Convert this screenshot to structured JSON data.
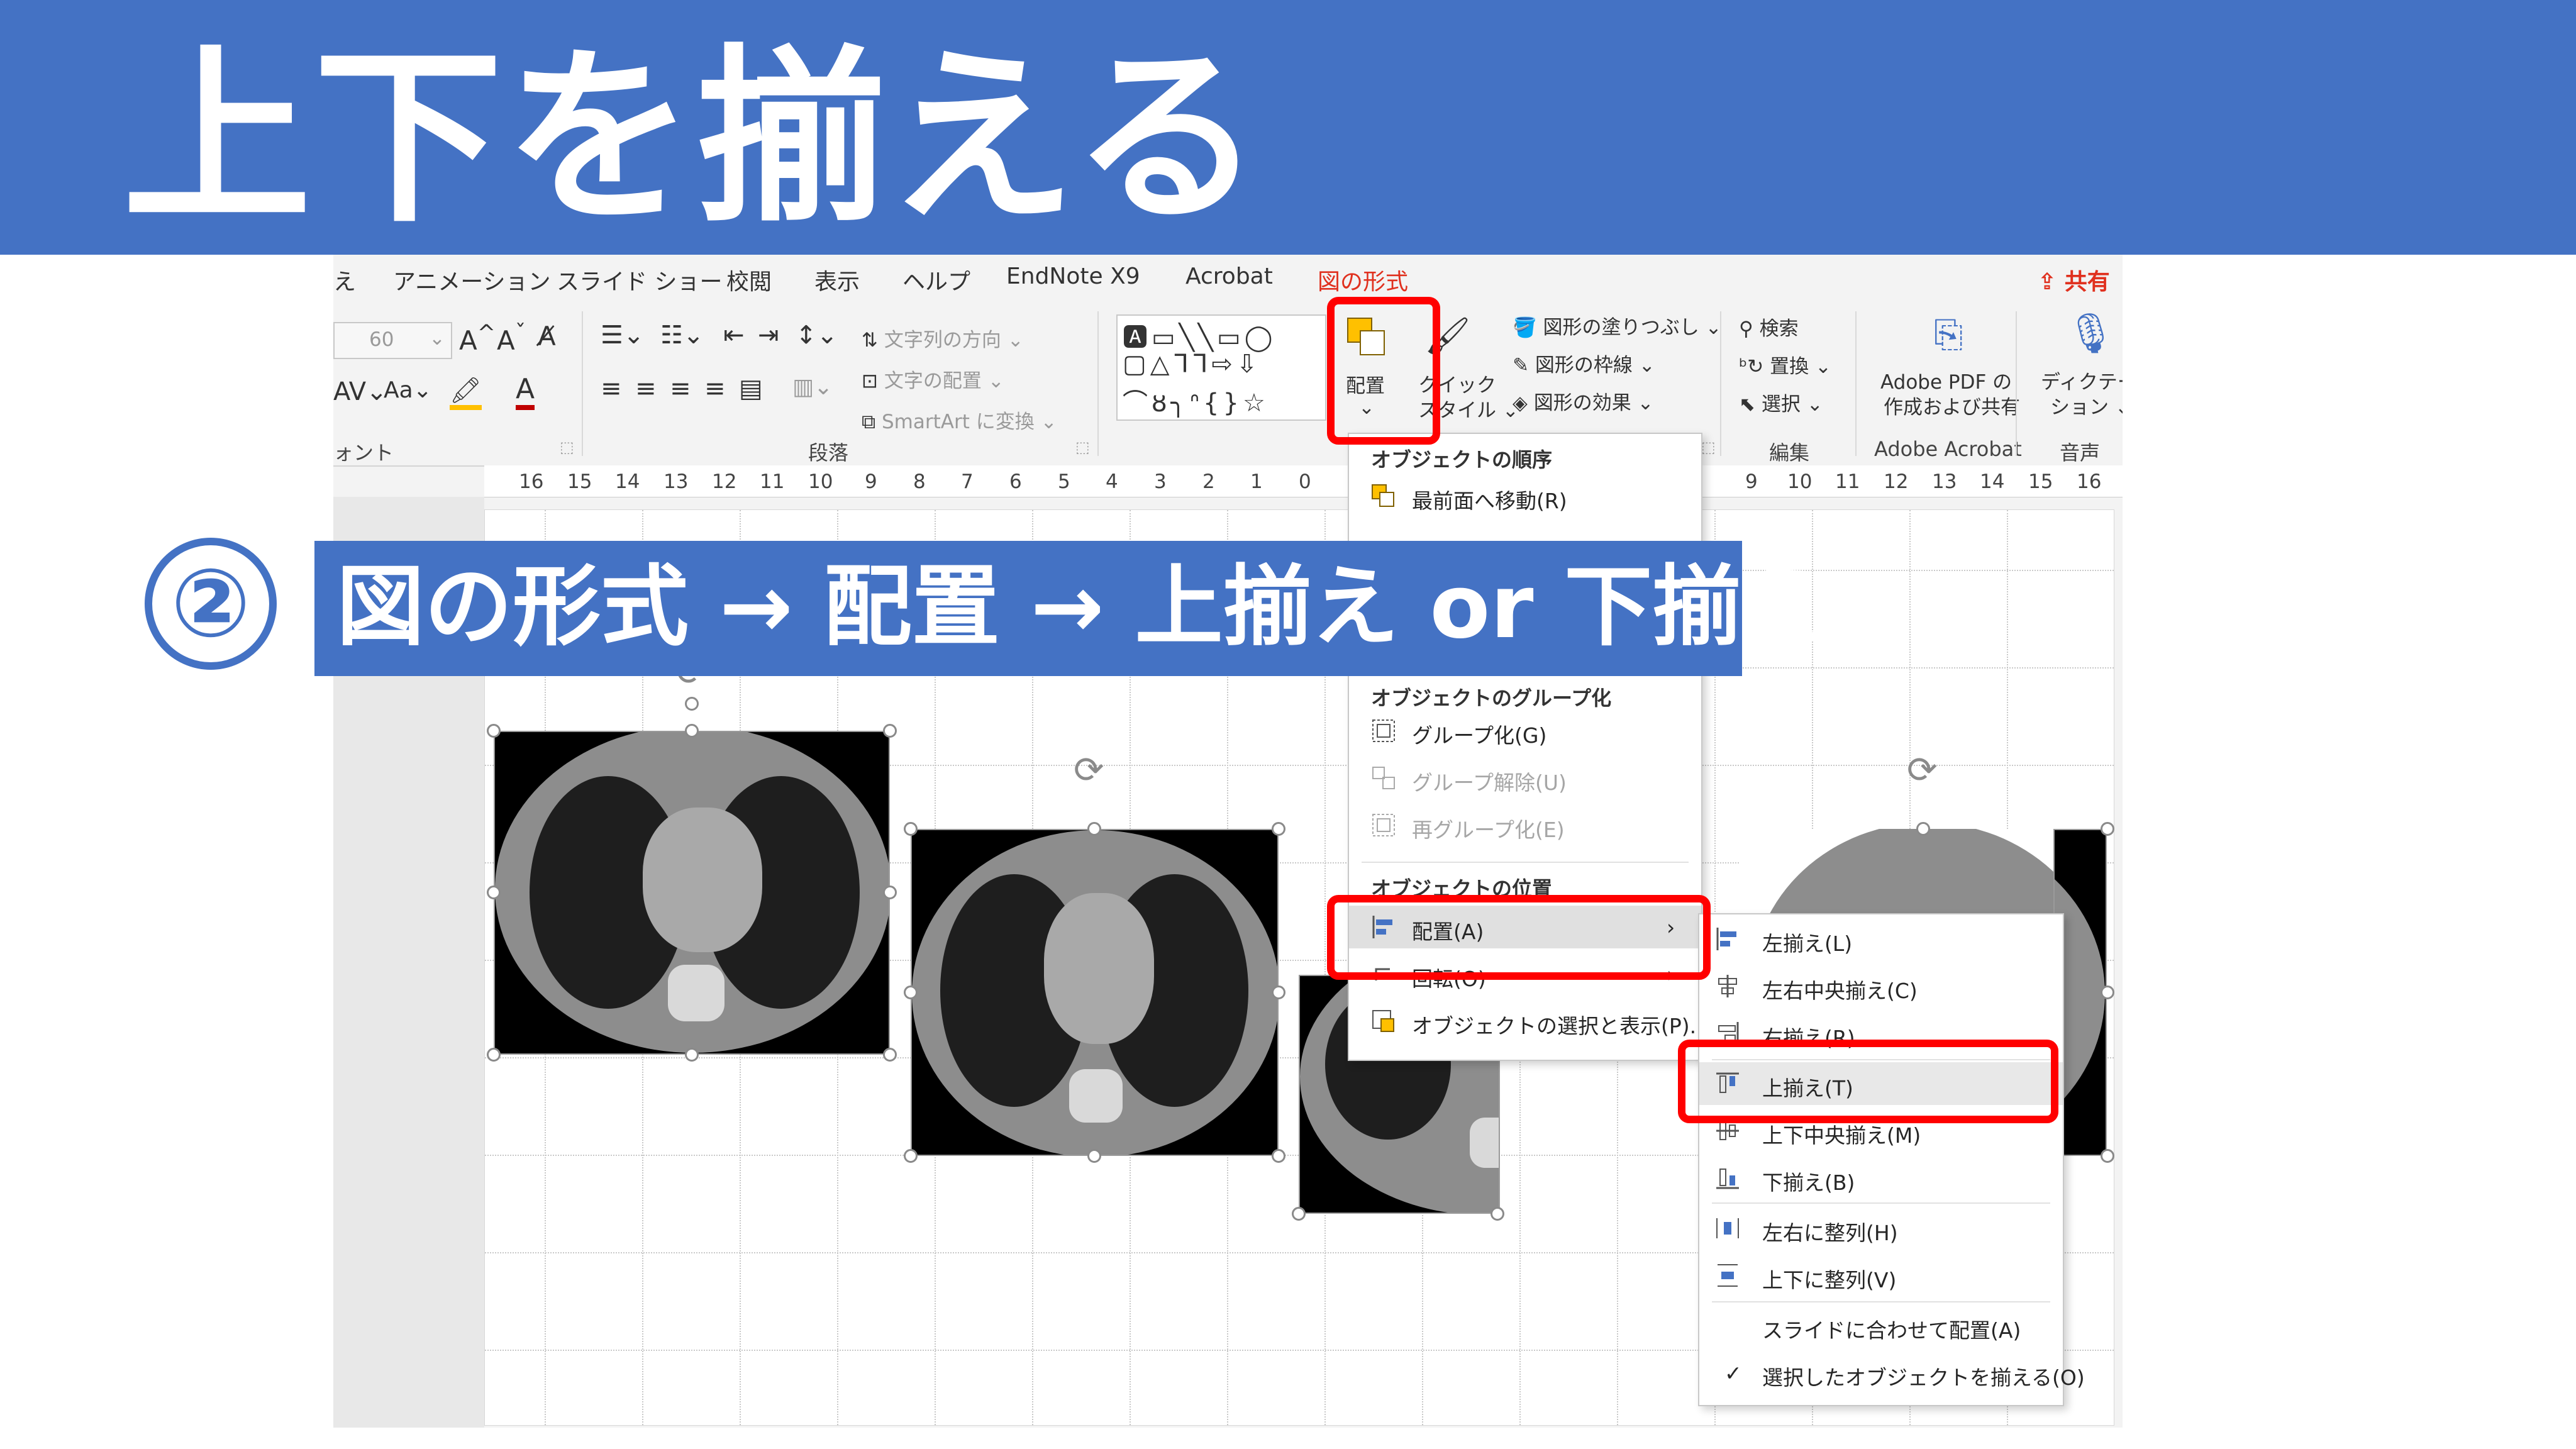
{
  "banner": {
    "title": "上下を揃える"
  },
  "step": {
    "number": "②",
    "text": "図の形式 → 配置 → 上揃え or 下揃え"
  },
  "menubar": {
    "items": [
      "え",
      "アニメーション",
      "スライド ショー",
      "校閲",
      "表示",
      "ヘルプ",
      "EndNote X9",
      "Acrobat",
      "図の形式"
    ],
    "share": "共有",
    "active_color": "#E0301E"
  },
  "ribbon": {
    "font_size": "60",
    "font_group": "ォント",
    "paragraph_group": "段落",
    "text_direction": "文字列の方向",
    "text_align": "文字の配置",
    "smartart": "SmartArt に変換",
    "arrange": "配置",
    "quick_style_1": "クイック",
    "quick_style_2": "スタイル",
    "shape_fill": "図形の塗りつぶし",
    "shape_outline": "図形の枠線",
    "shape_effects": "図形の効果",
    "search": "検索",
    "replace": "置換",
    "select": "選択",
    "edit_group": "編集",
    "adobe_pdf_1": "Adobe PDF の",
    "adobe_pdf_2": "作成および共有",
    "adobe_group": "Adobe Acrobat",
    "dictation_1": "ディクテー",
    "dictation_2": "ション",
    "voice_group": "音声"
  },
  "ruler": {
    "ticks": [
      "16",
      "15",
      "14",
      "13",
      "12",
      "11",
      "10",
      "9",
      "8",
      "7",
      "6",
      "5",
      "4",
      "3",
      "2",
      "1",
      "0",
      "9",
      "10",
      "11",
      "12",
      "13",
      "14",
      "15",
      "16"
    ]
  },
  "arrange_menu": {
    "order_header": "オブジェクトの順序",
    "bring_front": "最前面へ移動(R)",
    "group_header": "オブジェクトのグループ化",
    "group": "グループ化(G)",
    "ungroup": "グループ解除(U)",
    "regroup": "再グループ化(E)",
    "position_header": "オブジェクトの位置",
    "align": "配置(A)",
    "rotate": "回転(O)",
    "selection_pane": "オブジェクトの選択と表示(P)..."
  },
  "align_menu": {
    "left": "左揃え(L)",
    "center": "左右中央揃え(C)",
    "right": "右揃え(R)",
    "top": "上揃え(T)",
    "middle": "上下中央揃え(M)",
    "bottom": "下揃え(B)",
    "dist_h": "左右に整列(H)",
    "dist_v": "上下に整列(V)",
    "to_slide": "スライドに合わせて配置(A)",
    "to_selected": "選択したオブジェクトを揃える(O)",
    "check": "✓"
  },
  "colors": {
    "banner": "#4472C4",
    "highlight": "#FF0000"
  }
}
